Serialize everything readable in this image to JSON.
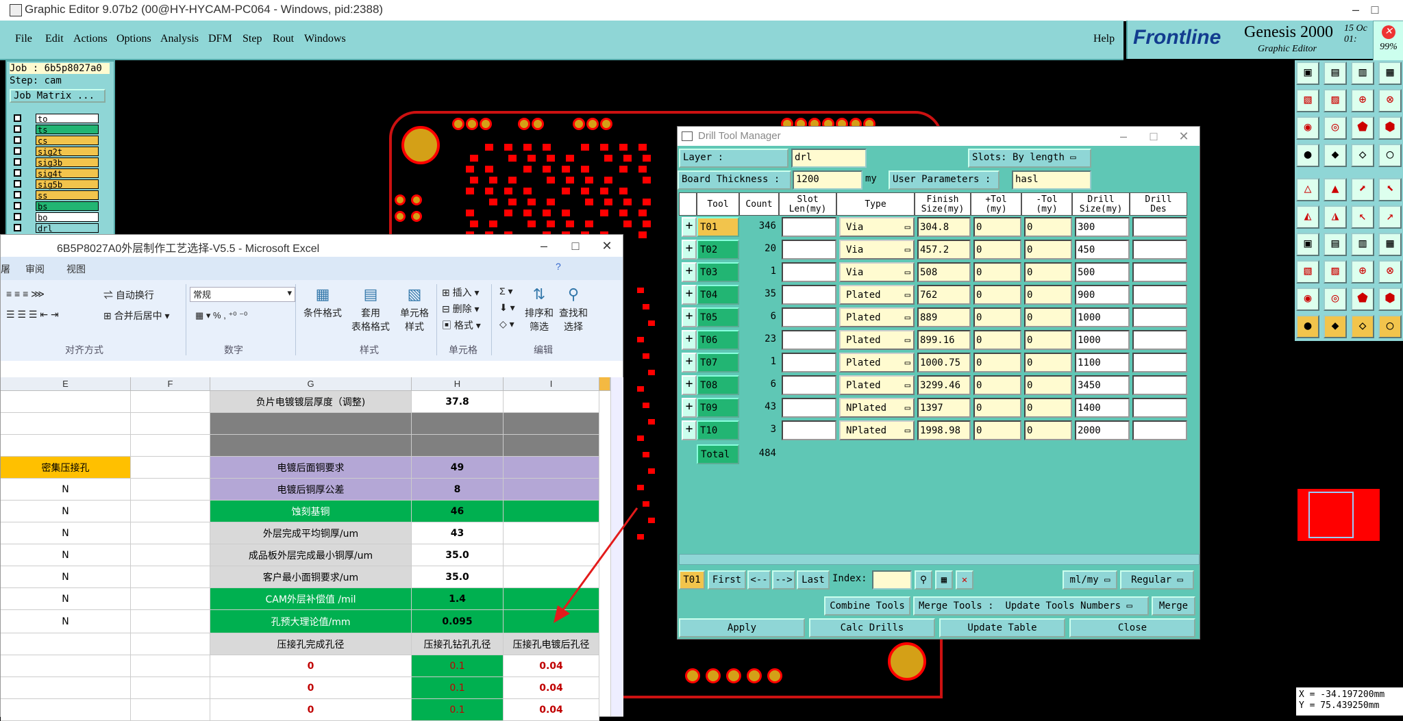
{
  "app": {
    "title": "Graphic Editor 9.07b2 (00@HY-HYCAM-PC064 - Windows, pid:2388)",
    "menu": [
      "File",
      "Edit",
      "Actions",
      "Options",
      "Analysis",
      "DFM",
      "Step",
      "Rout",
      "Windows"
    ],
    "help": "Help",
    "brand": "Frontline",
    "product": "Genesis 2000",
    "product_sub": "Graphic Editor",
    "date_line1": "15 Oc",
    "date_line2": "01:",
    "progress": "99%"
  },
  "job": {
    "job_label": "Job : 6b5p8027a0",
    "step_label": "Step: cam",
    "matrix_button": "Job Matrix ...",
    "layers": [
      {
        "name": "to",
        "color": "#ffffff"
      },
      {
        "name": "ts",
        "color": "#22b573"
      },
      {
        "name": "cs",
        "color": "#f2c44c"
      },
      {
        "name": "sig2t",
        "color": "#f2c44c"
      },
      {
        "name": "sig3b",
        "color": "#f2c44c"
      },
      {
        "name": "sig4t",
        "color": "#f2c44c"
      },
      {
        "name": "sig5b",
        "color": "#f2c44c"
      },
      {
        "name": "ss",
        "color": "#f2c44c"
      },
      {
        "name": "bs",
        "color": "#22b573"
      },
      {
        "name": "bo",
        "color": "#ffffff"
      },
      {
        "name": "drl",
        "color": "#8fd6d6"
      }
    ]
  },
  "coords": {
    "x": "X = -34.197200mm",
    "y": "Y = 75.439250mm"
  },
  "excel": {
    "title": "6B5P8027A0外层制作工艺选择-V5.5 - Microsoft Excel",
    "tabs": [
      "审阅",
      "视图"
    ],
    "wrap_text": "自动换行",
    "merge_center": "合并后居中",
    "number_format": "常规",
    "cond_format": "条件格式",
    "table_format_1": "套用",
    "table_format_2": "表格格式",
    "cell_style_1": "单元格",
    "cell_style_2": "样式",
    "insert": "插入",
    "delete": "删除",
    "format": "格式",
    "sort_filter_1": "排序和",
    "sort_filter_2": "筛选",
    "find_select_1": "查找和",
    "find_select_2": "选择",
    "percent": "%",
    "groups": [
      "对齐方式",
      "数字",
      "样式",
      "单元格",
      "编辑"
    ],
    "columns": [
      "E",
      "F",
      "G",
      "H",
      "I"
    ],
    "rows": [
      {
        "e": "",
        "g": "负片电镀镀层厚度（调整)",
        "h": "37.8",
        "i": "",
        "gbg": "#d9d9d9",
        "hbg": "#ffffff"
      },
      {
        "e": "",
        "g": "",
        "h": "",
        "i": "",
        "gbg": "#808080",
        "hbg": "#808080"
      },
      {
        "e": "",
        "g": "",
        "h": "",
        "i": "",
        "gbg": "#808080",
        "hbg": "#808080"
      },
      {
        "e": "密集压接孔",
        "g": "电镀后面铜要求",
        "h": "49",
        "i": "",
        "gbg": "#b4a7d6",
        "hbg": "#b4a7d6"
      },
      {
        "e": "N",
        "g": "电镀后铜厚公差",
        "h": "8",
        "i": "",
        "gbg": "#b4a7d6",
        "hbg": "#b4a7d6"
      },
      {
        "e": "N",
        "g": "蚀刻基铜",
        "h": "46",
        "i": "",
        "gbg": "#00b050",
        "hbg": "#00b050"
      },
      {
        "e": "N",
        "g": "外层完成平均铜厚/um",
        "h": "43",
        "i": "",
        "gbg": "#d9d9d9",
        "hbg": "#ffffff"
      },
      {
        "e": "N",
        "g": "成品板外层完成最小铜厚/um",
        "h": "35.0",
        "i": "",
        "gbg": "#d9d9d9",
        "hbg": "#ffffff"
      },
      {
        "e": "N",
        "g": "客户最小面铜要求/um",
        "h": "35.0",
        "i": "",
        "gbg": "#d9d9d9",
        "hbg": "#ffffff"
      },
      {
        "e": "N",
        "g": "CAM外层补偿值 /mil",
        "h": "1.4",
        "i": "",
        "gbg": "#00b050",
        "hbg": "#00b050"
      },
      {
        "e": "N",
        "g": "孔预大理论值/mm",
        "h": "0.095",
        "i": "",
        "gbg": "#00b050",
        "hbg": "#00b050"
      },
      {
        "e": "",
        "g": "压接孔完成孔径",
        "h": "压接孔钻孔孔径",
        "i": "压接孔电镀后孔径",
        "gbg": "#d9d9d9",
        "hbg": "#d9d9d9"
      },
      {
        "e": "",
        "g": "0",
        "h": "0.1",
        "i": "0.04",
        "gbg": "#ffffff",
        "hbg": "#00b050"
      },
      {
        "e": "",
        "g": "0",
        "h": "0.1",
        "i": "0.04",
        "gbg": "#ffffff",
        "hbg": "#00b050"
      },
      {
        "e": "",
        "g": "0",
        "h": "0.1",
        "i": "0.04",
        "gbg": "#ffffff",
        "hbg": "#00b050"
      }
    ]
  },
  "dtm": {
    "title": "Drill Tool Manager",
    "layer_label": "Layer :",
    "layer_value": "drl",
    "slots_label": "Slots:",
    "slots_value": "By length",
    "board_label": "Board Thickness :",
    "board_value": "1200",
    "board_unit": "my",
    "user_params_label": "User Parameters :",
    "user_params_value": "hasl",
    "headers": [
      "Tool",
      "Count",
      "Slot\nLen(my)",
      "Type",
      "Finish\nSize(my)",
      "+Tol\n(my)",
      "-Tol\n(my)",
      "Drill\nSize(my)",
      "Drill\nDes"
    ],
    "tools": [
      {
        "tool": "T01",
        "count": "346",
        "type": "Via",
        "finish": "304.8",
        "ptol": "0",
        "ntol": "0",
        "drill": "300"
      },
      {
        "tool": "T02",
        "count": "20",
        "type": "Via",
        "finish": "457.2",
        "ptol": "0",
        "ntol": "0",
        "drill": "450"
      },
      {
        "tool": "T03",
        "count": "1",
        "type": "Via",
        "finish": "508",
        "ptol": "0",
        "ntol": "0",
        "drill": "500"
      },
      {
        "tool": "T04",
        "count": "35",
        "type": "Plated",
        "finish": "762",
        "ptol": "0",
        "ntol": "0",
        "drill": "900"
      },
      {
        "tool": "T05",
        "count": "6",
        "type": "Plated",
        "finish": "889",
        "ptol": "0",
        "ntol": "0",
        "drill": "1000"
      },
      {
        "tool": "T06",
        "count": "23",
        "type": "Plated",
        "finish": "899.16",
        "ptol": "0",
        "ntol": "0",
        "drill": "1000"
      },
      {
        "tool": "T07",
        "count": "1",
        "type": "Plated",
        "finish": "1000.75",
        "ptol": "0",
        "ntol": "0",
        "drill": "1100"
      },
      {
        "tool": "T08",
        "count": "6",
        "type": "Plated",
        "finish": "3299.46",
        "ptol": "0",
        "ntol": "0",
        "drill": "3450"
      },
      {
        "tool": "T09",
        "count": "43",
        "type": "NPlated",
        "finish": "1397",
        "ptol": "0",
        "ntol": "0",
        "drill": "1400"
      },
      {
        "tool": "T10",
        "count": "3",
        "type": "NPlated",
        "finish": "1998.98",
        "ptol": "0",
        "ntol": "0",
        "drill": "2000"
      }
    ],
    "total_label": "Total",
    "total_count": "484",
    "nav_current": "T01",
    "nav_first": "First",
    "nav_prev": "<--",
    "nav_next": "-->",
    "nav_last": "Last",
    "index_label": "Index:",
    "units": "ml/my",
    "mode": "Regular",
    "combine_tools": "Combine Tools",
    "merge_tools_label": "Merge Tools :",
    "update_tools_numbers": "Update Tools Numbers",
    "merge": "Merge",
    "apply": "Apply",
    "calc_drills": "Calc Drills",
    "update_table": "Update Table",
    "close": "Close"
  }
}
